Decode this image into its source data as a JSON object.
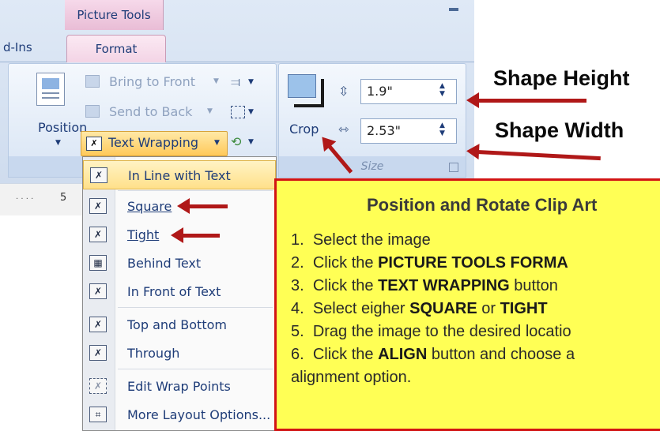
{
  "ribbon": {
    "context_tab": "Picture Tools",
    "tabs": [
      "d-Ins",
      "Format"
    ],
    "arrange": {
      "bring_to_front": "Bring to Front",
      "send_to_back": "Send to Back",
      "position": "Position",
      "text_wrapping": "Text Wrapping"
    },
    "size": {
      "crop": "Crop",
      "height_value": "1.9\"",
      "width_value": "2.53\"",
      "group_label": "Size"
    }
  },
  "ruler": {
    "marker": "5"
  },
  "menu": {
    "items": [
      {
        "label": "In Line with Text",
        "icon": "wrap-inline-icon",
        "selected": true
      },
      {
        "label": "Square",
        "icon": "wrap-square-icon"
      },
      {
        "label": "Tight",
        "icon": "wrap-tight-icon"
      },
      {
        "label": "Behind Text",
        "icon": "wrap-behind-icon"
      },
      {
        "label": "In Front of Text",
        "icon": "wrap-front-icon"
      },
      {
        "label": "Top and Bottom",
        "icon": "wrap-top-bottom-icon"
      },
      {
        "label": "Through",
        "icon": "wrap-through-icon"
      },
      {
        "label": "Edit Wrap Points",
        "icon": "edit-wrap-points-icon",
        "disabled": true
      },
      {
        "label": "More Layout Options...",
        "icon": "layout-options-icon"
      }
    ]
  },
  "annotations": {
    "shape_height": "Shape Height",
    "shape_width": "Shape Width"
  },
  "callout": {
    "title": "Position and Rotate Clip Art",
    "steps": [
      {
        "num": "1.",
        "pre": "Select the image",
        "bold": "",
        "post": ""
      },
      {
        "num": "2.",
        "pre": "Click the ",
        "bold": "PICTURE TOOLS FORMA",
        "post": ""
      },
      {
        "num": "3.",
        "pre": "Click the ",
        "bold": "TEXT WRAPPING",
        "post": " button"
      },
      {
        "num": "4.",
        "pre": "Select eigher ",
        "bold": "SQUARE",
        "post": " or "
      },
      {
        "num": "5.",
        "pre": "Drag the image to the desired locatio",
        "bold": "",
        "post": ""
      },
      {
        "num": "6.",
        "pre": "Click the ",
        "bold": "ALIGN",
        "post": " button and choose a"
      }
    ],
    "step4_bold2": "TIGHT",
    "step6_cont": "alignment option."
  },
  "colors": {
    "accent_red": "#b01818",
    "callout_bg": "#ffff55",
    "callout_border": "#d21414"
  }
}
